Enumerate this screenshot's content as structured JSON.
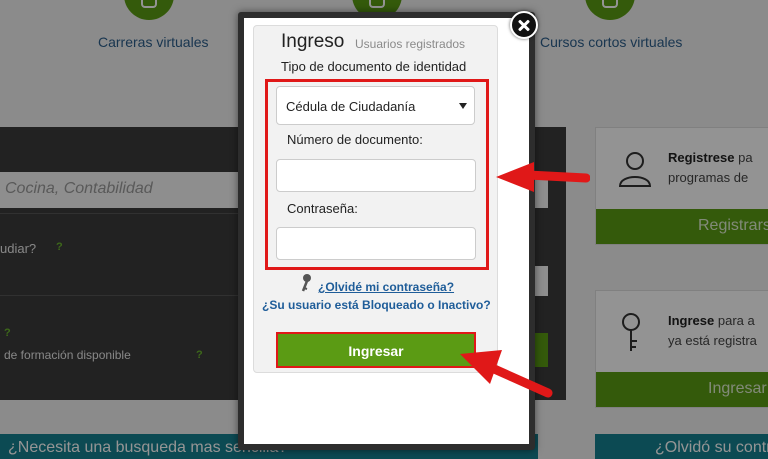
{
  "background": {
    "nav": [
      {
        "label": "Carreras virtuales"
      },
      {
        "label": "Cursos cortos virtuales"
      }
    ],
    "left": {
      "search_placeholder": "Cocina, Contabilidad",
      "question": "udiar?",
      "help_mark": "?",
      "formation": "de formación disponible",
      "simple_search": "¿Necesita una busqueda mas sencilla?"
    },
    "cards": [
      {
        "strong": "Registrese",
        "rest": " pa",
        "line2": "programas de",
        "button": "Registrars",
        "icon": "user-icon"
      },
      {
        "strong": "Ingrese",
        "rest": " para a",
        "line2": "ya está registra",
        "button": "Ingresar",
        "icon": "key-icon"
      }
    ],
    "bottom_right": "¿Olvidó su contr"
  },
  "modal": {
    "title": "Ingreso",
    "subtitle": "Usuarios registrados",
    "doc_type_label": "Tipo de documento de identidad",
    "doc_type_value": "Cédula de Ciudadanía",
    "doc_number_label": "Número de documento:",
    "doc_number_value": "",
    "password_label": "Contraseña:",
    "password_value": "",
    "forgot_password": "¿Olvidé mi contraseña?",
    "blocked_user": "¿Su usuario está Bloqueado o Inactivo?",
    "submit_label": "Ingresar",
    "close_icon": "close-icon"
  },
  "colors": {
    "brand_green": "#5b9b14",
    "highlight_red": "#e01818",
    "link_blue": "#1f5d99",
    "teal_bar": "#15808f"
  }
}
